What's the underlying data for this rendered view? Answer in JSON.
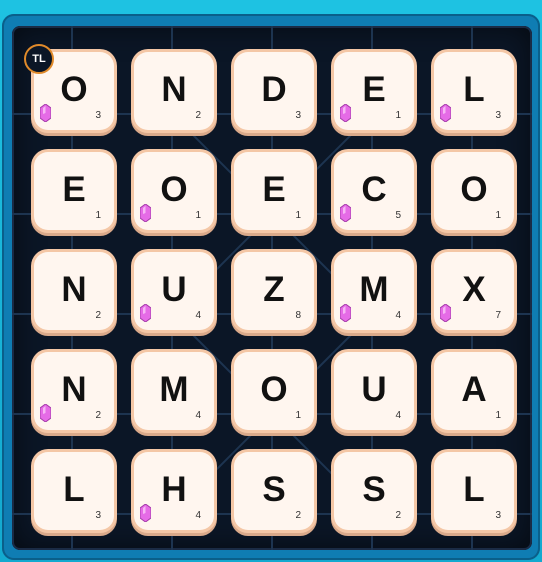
{
  "badge": {
    "text": "TL"
  },
  "tiles": [
    {
      "letter": "O",
      "score": "3",
      "gem": true
    },
    {
      "letter": "N",
      "score": "2",
      "gem": false
    },
    {
      "letter": "D",
      "score": "3",
      "gem": false
    },
    {
      "letter": "E",
      "score": "1",
      "gem": true
    },
    {
      "letter": "L",
      "score": "3",
      "gem": true
    },
    {
      "letter": "E",
      "score": "1",
      "gem": false
    },
    {
      "letter": "O",
      "score": "1",
      "gem": true
    },
    {
      "letter": "E",
      "score": "1",
      "gem": false
    },
    {
      "letter": "C",
      "score": "5",
      "gem": true
    },
    {
      "letter": "O",
      "score": "1",
      "gem": false
    },
    {
      "letter": "N",
      "score": "2",
      "gem": false
    },
    {
      "letter": "U",
      "score": "4",
      "gem": true
    },
    {
      "letter": "Z",
      "score": "8",
      "gem": false
    },
    {
      "letter": "M",
      "score": "4",
      "gem": true
    },
    {
      "letter": "X",
      "score": "7",
      "gem": true
    },
    {
      "letter": "N",
      "score": "2",
      "gem": true
    },
    {
      "letter": "M",
      "score": "4",
      "gem": false
    },
    {
      "letter": "O",
      "score": "1",
      "gem": false
    },
    {
      "letter": "U",
      "score": "4",
      "gem": false
    },
    {
      "letter": "A",
      "score": "1",
      "gem": false
    },
    {
      "letter": "L",
      "score": "3",
      "gem": false
    },
    {
      "letter": "H",
      "score": "4",
      "gem": true
    },
    {
      "letter": "S",
      "score": "2",
      "gem": false
    },
    {
      "letter": "S",
      "score": "2",
      "gem": false
    },
    {
      "letter": "L",
      "score": "3",
      "gem": false
    }
  ],
  "colors": {
    "board": "#0b1626",
    "frame": "#0f7db3",
    "tile": "#fff6ef",
    "tile_border": "#f4c7a6",
    "gem": "#e56be6",
    "badge_ring": "#e08a2a"
  }
}
